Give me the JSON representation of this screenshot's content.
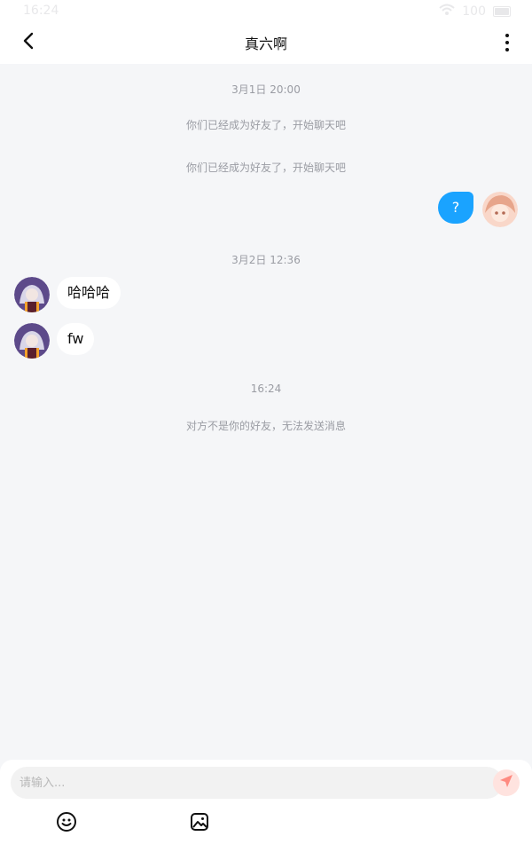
{
  "status_bar": {
    "time": "16:24",
    "battery": "100"
  },
  "header": {
    "title": "真六啊"
  },
  "chat": {
    "time_1": "3月1日 20:00",
    "notice_1": "你们已经成为好友了，开始聊天吧",
    "notice_2": "你们已经成为好友了，开始聊天吧",
    "msg_self_1": "?",
    "time_2": "3月2日 12:36",
    "msg_other_1": "哈哈哈",
    "msg_other_2": "fw",
    "time_3": "16:24",
    "notice_3": "对方不是你的好友，无法发送消息"
  },
  "input": {
    "placeholder": "请输入..."
  },
  "icons": [
    "back-arrow-icon",
    "more-vertical-icon",
    "send-icon",
    "emoji-icon",
    "image-icon",
    "wifi-icon",
    "battery-icon"
  ],
  "colors": {
    "accent": "#1aa3ff",
    "background": "#f5f6f8",
    "send_bg": "#ffe3df",
    "send_icon": "#ff8a80"
  }
}
